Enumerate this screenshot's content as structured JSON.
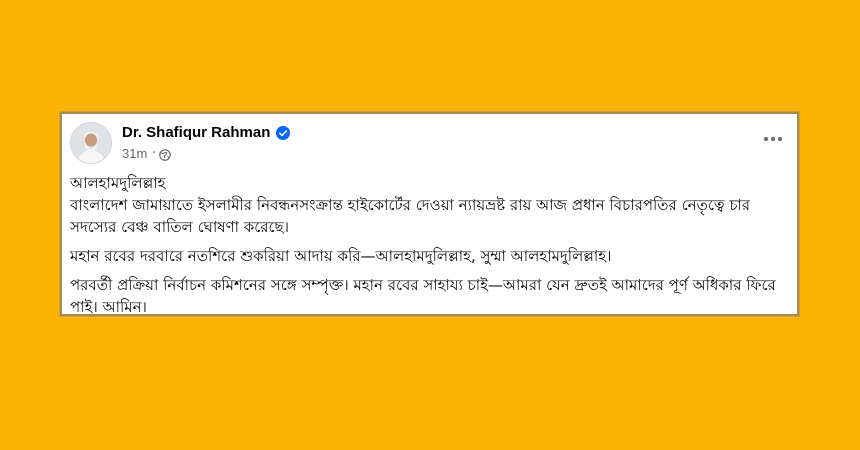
{
  "post": {
    "author_name": "Dr. Shafiqur Rahman",
    "timestamp": "31m",
    "separator": "·",
    "paragraphs": [
      {
        "lines": [
          "আলহামদুলিল্লাহ",
          "বাংলাদেশ জামায়াতে ইসলামীর নিবন্ধনসংক্রান্ত হাইকোর্টের দেওয়া ন্যায়ভ্রষ্ট রায় আজ প্রধান বিচারপতির নেতৃত্বে চার সদস্যের বেঞ্চ বাতিল ঘোষণা করেছে।"
        ]
      },
      {
        "lines": [
          "মহান রবের দরবারে নতশিরে শুকরিয়া আদায় করি—আলহামদুলিল্লাহ, সুম্মা আলহামদুলিল্লাহ।"
        ]
      },
      {
        "lines": [
          "পরবর্তী প্রক্রিয়া নির্বাচন কমিশনের সঙ্গে সম্পৃক্ত। মহান রবের সাহায্য চাই—আমরা যেন দ্রুতই আমাদের পূর্ণ অধিকার ফিরে পাই। আমিন।"
        ]
      }
    ]
  },
  "colors": {
    "background": "#fdb400",
    "card_border": "#a78a43",
    "verified_badge": "#0866ff",
    "meta_text": "#65676b"
  },
  "icons": {
    "verified": "verified-badge-icon",
    "audience": "globe-icon",
    "menu": "more-options-icon"
  }
}
